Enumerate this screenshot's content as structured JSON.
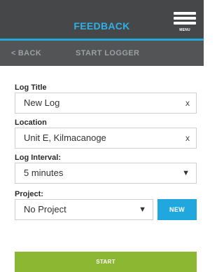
{
  "header": {
    "title": "FEEDBACK",
    "menu_label": "MENU"
  },
  "subheader": {
    "back_label": "BACK",
    "back_icon": "chevron-left-icon",
    "screen_title": "START LOGGER"
  },
  "form": {
    "log_title": {
      "label": "Log Title",
      "value": "New Log",
      "clear_icon": "x"
    },
    "location": {
      "label": "Location",
      "value": "Unit E, Kilmacanoge",
      "clear_icon": "x"
    },
    "log_interval": {
      "label": "Log Interval:",
      "value": "5 minutes",
      "arrow": "▼"
    },
    "project": {
      "label": "Project:",
      "value": "No Project",
      "arrow": "▼",
      "new_label": "NEW"
    }
  },
  "actions": {
    "start_label": "START"
  },
  "colors": {
    "header_bg": "#454749",
    "accent": "#22a8dc",
    "subheader_bg": "#525456",
    "new_button": "#1fa7de",
    "start_button": "#8bb733"
  }
}
